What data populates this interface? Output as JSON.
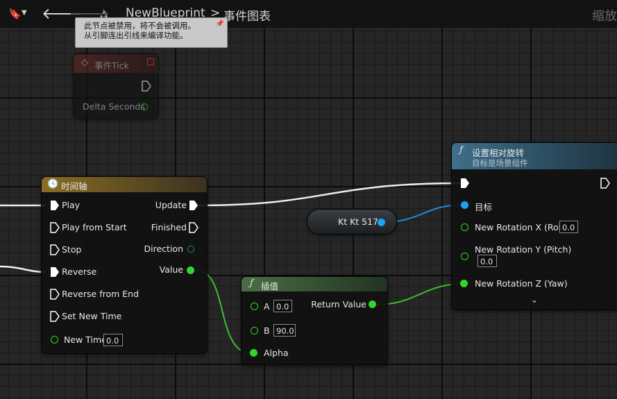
{
  "toolbar": {
    "bookmark_icon": "bookmark-icon",
    "back_icon": "back-arrow-icon",
    "forward_icon": "forward-arrow-icon",
    "blueprint_icon": "blueprint-tree-icon",
    "blueprint_name": "NewBlueprint",
    "separator": ">",
    "graph_name": "事件图表",
    "zoom_label": "缩放"
  },
  "tooltip": {
    "line1": "此节点被禁用，将不会被调用。",
    "line2": "从引脚连出引线来编译功能。",
    "pin": "📌"
  },
  "event_tick": {
    "title": "事件Tick",
    "output": "Delta Seconds"
  },
  "timeline": {
    "title": "时间轴",
    "inputs": [
      "Play",
      "Play from Start",
      "Stop",
      "Reverse",
      "Reverse from End",
      "Set New Time"
    ],
    "new_time_label": "New Time",
    "new_time_value": "0.0",
    "outputs": [
      "Update",
      "Finished",
      "Direction",
      "Value"
    ]
  },
  "variable": {
    "label": "Kt Kt 517"
  },
  "lerp": {
    "title": "插值",
    "a_label": "A",
    "a_value": "0.0",
    "b_label": "B",
    "b_value": "90.0",
    "alpha_label": "Alpha",
    "output": "Return Value"
  },
  "set_rotation": {
    "title": "设置相对旋转",
    "subtitle": "目标是场景组件",
    "target_label": "目标",
    "x_label": "New Rotation X (Roll)",
    "x_value": "0.0",
    "y_label": "New Rotation Y (Pitch)",
    "y_value": "0.0",
    "z_label": "New Rotation Z (Yaw)",
    "expand_icon": "chevron-down-icon"
  },
  "colors": {
    "exec": "#ffffff",
    "float_pin": "#35d429",
    "object_pin": "#1aa3f0",
    "wire_float": "#39b72a",
    "wire_object": "#1a8fd6"
  }
}
